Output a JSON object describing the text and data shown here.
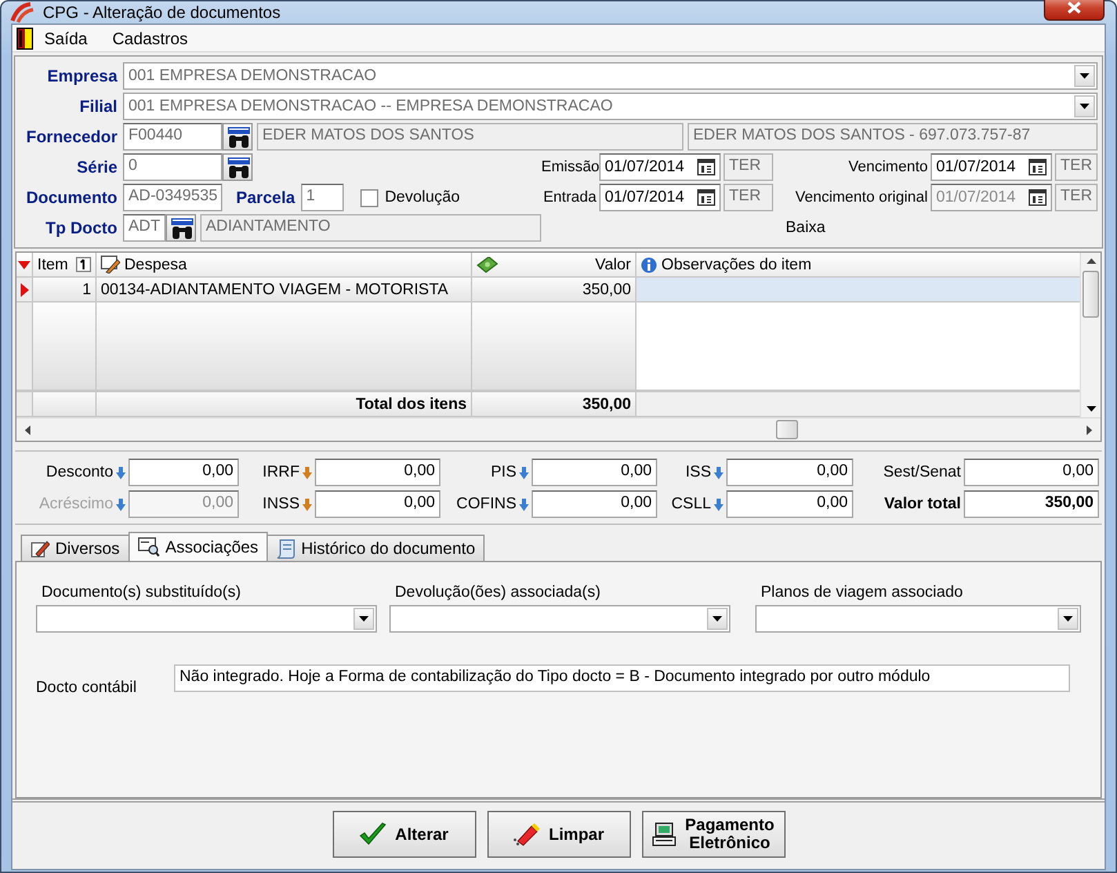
{
  "window": {
    "title": "CPG - Alteração de documentos"
  },
  "menu": [
    {
      "label": "Saída"
    },
    {
      "label": "Cadastros"
    }
  ],
  "empresa": {
    "label": "Empresa",
    "value": "001 EMPRESA DEMONSTRACAO"
  },
  "filial": {
    "label": "Filial",
    "value": "001 EMPRESA DEMONSTRACAO -- EMPRESA DEMONSTRACAO"
  },
  "fornecedor": {
    "label": "Fornecedor",
    "code": "F00440",
    "name": "EDER MATOS DOS SANTOS",
    "description": "EDER MATOS DOS SANTOS - 697.073.757-87"
  },
  "serie": {
    "label": "Série",
    "value": "0"
  },
  "documento": {
    "label": "Documento",
    "value": "AD-0349535"
  },
  "parcela": {
    "label": "Parcela",
    "value": "1"
  },
  "devolucao": {
    "label": "Devolução",
    "checked": false
  },
  "tp_docto": {
    "label": "Tp Docto",
    "code": "ADT",
    "name": "ADIANTAMENTO"
  },
  "dates": [
    {
      "label": "Emissão",
      "value": "01/07/2014",
      "weekday": "TER",
      "disabled": false
    },
    {
      "label": "Vencimento",
      "value": "01/07/2014",
      "weekday": "TER",
      "disabled": false
    },
    {
      "label": "Entrada",
      "value": "01/07/2014",
      "weekday": "TER",
      "disabled": false
    },
    {
      "label": "Vencimento original",
      "value": "01/07/2014",
      "weekday": "TER",
      "disabled": true
    }
  ],
  "baixa": "Baixa",
  "table": {
    "columns": [
      {
        "label": "Item"
      },
      {
        "label": "Despesa"
      },
      {
        "label": "Valor"
      },
      {
        "label": "Observações do item"
      }
    ],
    "rows": [
      {
        "item": "1",
        "despesa": "00134-ADIANTAMENTO VIAGEM -  MOTORISTA",
        "valor": "350,00",
        "selected": true
      }
    ],
    "total": {
      "label": "Total dos itens",
      "value": "350,00"
    }
  },
  "totals": [
    {
      "label": "Desconto",
      "value": "0,00",
      "kind": "adjust",
      "color": "#3a7fd0",
      "disabled": false
    },
    {
      "label": "IRRF",
      "value": "0,00",
      "kind": "adjust",
      "color": "#d08020",
      "disabled": false
    },
    {
      "label": "PIS",
      "value": "0,00",
      "kind": "adjust",
      "color": "#3a7fd0",
      "disabled": false
    },
    {
      "label": "ISS",
      "value": "0,00",
      "kind": "adjust",
      "color": "#3a7fd0",
      "disabled": false
    },
    {
      "label": "Sest/Senat",
      "value": "0,00",
      "kind": "plain",
      "disabled": false
    },
    {
      "label": "Acréscimo",
      "value": "0,00",
      "kind": "adjust",
      "color": "#3a7fd0",
      "disabled": true
    },
    {
      "label": "INSS",
      "value": "0,00",
      "kind": "adjust",
      "color": "#d08020",
      "disabled": false
    },
    {
      "label": "COFINS",
      "value": "0,00",
      "kind": "adjust",
      "color": "#3a7fd0",
      "disabled": false
    },
    {
      "label": "CSLL",
      "value": "0,00",
      "kind": "adjust",
      "color": "#3a7fd0",
      "disabled": false
    },
    {
      "label": "Valor total",
      "value": "350,00",
      "kind": "total",
      "disabled": false
    }
  ],
  "tabs": [
    {
      "label": "Diversos",
      "selected": false
    },
    {
      "label": "Associações",
      "selected": true
    },
    {
      "label": "Histórico do documento",
      "selected": false
    }
  ],
  "associations": [
    {
      "label": "Documento(s) substituído(s)"
    },
    {
      "label": "Devolução(ões) associada(s)"
    },
    {
      "label": "Planos de viagem associado"
    }
  ],
  "docto_contabil": {
    "label": "Docto contábil",
    "value": "Não integrado. Hoje a Forma de contabilização do Tipo docto = B - Documento integrado por outro módulo"
  },
  "buttons": [
    {
      "label": "Alterar"
    },
    {
      "label": "Limpar"
    },
    {
      "label": "Pagamento Eletrônico"
    }
  ]
}
